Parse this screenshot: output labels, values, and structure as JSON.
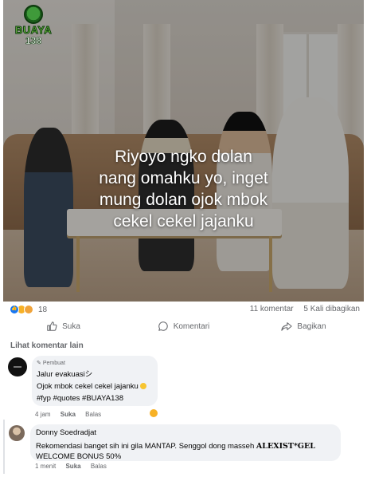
{
  "post": {
    "logo": {
      "word": "BUAYA",
      "number": "138"
    },
    "caption": [
      "Riyoyo ngko dolan",
      "nang omahku yo, inget",
      "mung dolan ojok mbok",
      "cekel cekel jajanku"
    ],
    "reaction_count": "18",
    "comments_count": "11 komentar",
    "shares_count": "5 Kali dibagikan"
  },
  "actions": {
    "like": "Suka",
    "comment": "Komentari",
    "share": "Bagikan"
  },
  "comments": {
    "see_more": "Lihat komentar lain",
    "first": {
      "author_tag": "Pembuat",
      "author": "Jalur evakuasiシ",
      "text": "Ojok mbok cekel cekel jajanku",
      "hashtags": "#fyp #quotes #BUAYA138",
      "time": "4 jam",
      "like": "Suka",
      "reply": "Balas"
    },
    "second": {
      "author": "Donny Soedradjat",
      "text_plain": "Rekomendasi banget sih ini gila MANTAP. Senggol dong masseh",
      "text_strong": "ALEXIST*GEL",
      "text_line2": "WELCOME BONUS 50%",
      "time": "1 menit",
      "like": "Suka",
      "reply": "Balas"
    }
  },
  "icons": {
    "like": "thumbs-up-icon",
    "comment": "speech-bubble-icon",
    "share": "share-arrow-icon",
    "author_tag": "pen-icon"
  },
  "colors": {
    "link_blue": "#1877f2",
    "text_secondary": "#65676b",
    "bubble_bg": "#f0f2f5"
  }
}
